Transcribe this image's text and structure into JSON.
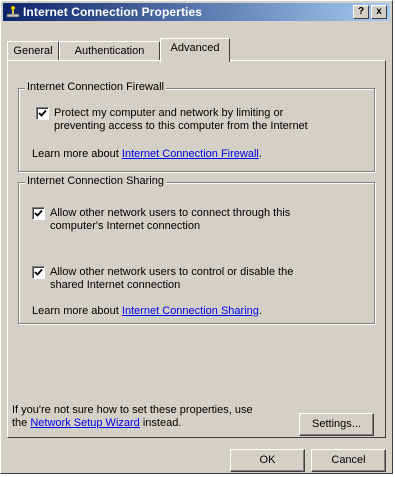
{
  "window": {
    "title": "Internet Connection Properties",
    "help_label": "?",
    "close_label": "x"
  },
  "tabs": [
    {
      "label": "General"
    },
    {
      "label": "Authentication"
    },
    {
      "label": "Advanced"
    }
  ],
  "firewall": {
    "group_title": "Internet Connection Firewall",
    "checkbox_line1": "Protect my computer and network by limiting or",
    "checkbox_line2": "preventing access to this computer from the Internet",
    "learn_prefix": "Learn more about ",
    "learn_link": "Internet Connection Firewall",
    "learn_suffix": "."
  },
  "sharing": {
    "group_title": "Internet Connection Sharing",
    "option1_line1": "Allow other network users to connect through this",
    "option1_line2": "computer's Internet connection",
    "option2_line1": "Allow other network users to control or disable the",
    "option2_line2": "shared Internet connection",
    "learn_prefix": "Learn more about ",
    "learn_link": "Internet Connection Sharing",
    "learn_suffix": "."
  },
  "footer": {
    "line1": "If you're not sure how to set these properties, use",
    "line2_prefix": "the ",
    "wizard_link": "Network Setup Wizard",
    "line2_suffix": " instead.",
    "settings_label": "Settings..."
  },
  "buttons": {
    "ok_label": "OK",
    "cancel_label": "Cancel"
  },
  "checkbox_state": {
    "firewall": true,
    "sharing_connect": true,
    "sharing_control": true
  }
}
